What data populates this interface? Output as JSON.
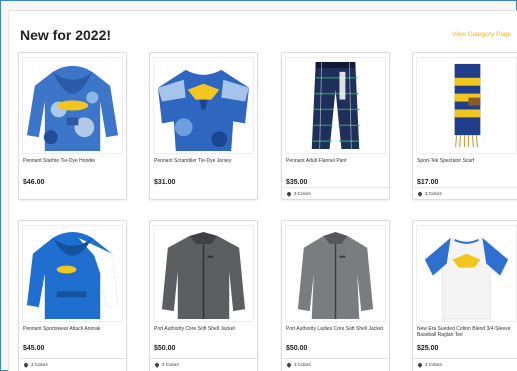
{
  "section": {
    "title": "New for 2022!",
    "category_link": "View Category Page"
  },
  "products": [
    {
      "name": "Pennant Starfire Tie-Dye Hoodie",
      "price": "$46.00",
      "colors": ""
    },
    {
      "name": "Pennant Scrambler Tie-Dye Jersey",
      "price": "$31.00",
      "colors": ""
    },
    {
      "name": "Pennant Adult Flannel Pant",
      "price": "$35.00",
      "colors": "3 Colors"
    },
    {
      "name": "Sport-Tek Spectator Scarf",
      "price": "$17.00",
      "colors": "3 Colors"
    },
    {
      "name": "Pennant Sportswear Attack Anorak",
      "price": "$45.00",
      "colors": "3 Colors"
    },
    {
      "name": "Port Authority Core Soft Shell Jacket",
      "price": "$50.00",
      "colors": "3 Colors"
    },
    {
      "name": "Port Authority Ladies Core Soft Shell Jacket",
      "price": "$50.00",
      "colors": "3 Colors"
    },
    {
      "name": "New Era Sueded Cotton Blend 3/4-Sleeve Baseball Raglan Tee",
      "price": "$25.00",
      "colors": "3 Colors"
    }
  ]
}
